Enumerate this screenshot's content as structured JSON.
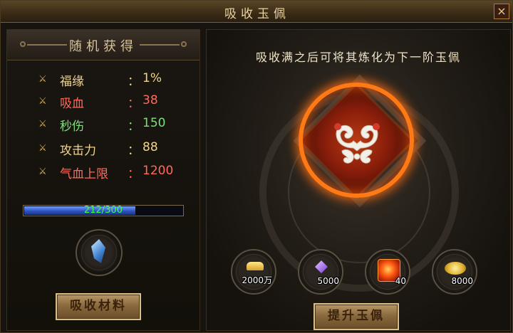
{
  "window": {
    "title": "吸收玉佩",
    "close_glyph": "×"
  },
  "left": {
    "header": "随机获得",
    "stats": [
      {
        "label": "福缘",
        "sep": "：",
        "value": "1%",
        "color": "#f2d58a"
      },
      {
        "label": "吸血",
        "sep": "：",
        "value": "38",
        "color": "#ff6a5a"
      },
      {
        "label": "秒伤",
        "sep": "：",
        "value": "150",
        "color": "#7de07a"
      },
      {
        "label": "攻击力",
        "sep": "：",
        "value": "88",
        "color": "#f2d58a"
      },
      {
        "label": "气血上限",
        "sep": "：",
        "value": "1200",
        "color": "#ff6a5a"
      }
    ],
    "progress": {
      "text": "212/300",
      "current": 212,
      "max": 300
    },
    "material_slot_icon": "blue-crystal-icon",
    "absorb_button": "吸收材料"
  },
  "right": {
    "hint": "吸收满之后可将其炼化为下一阶玉佩",
    "jade_icon": "jade-pendant-icon",
    "costs": [
      {
        "icon": "gold-ingot-icon",
        "amount": "2000万"
      },
      {
        "icon": "purple-gem-icon",
        "amount": "5000"
      },
      {
        "icon": "red-orb-icon",
        "amount": "40"
      },
      {
        "icon": "gold-coins-icon",
        "amount": "8000"
      }
    ],
    "upgrade_button": "提升玉佩"
  }
}
